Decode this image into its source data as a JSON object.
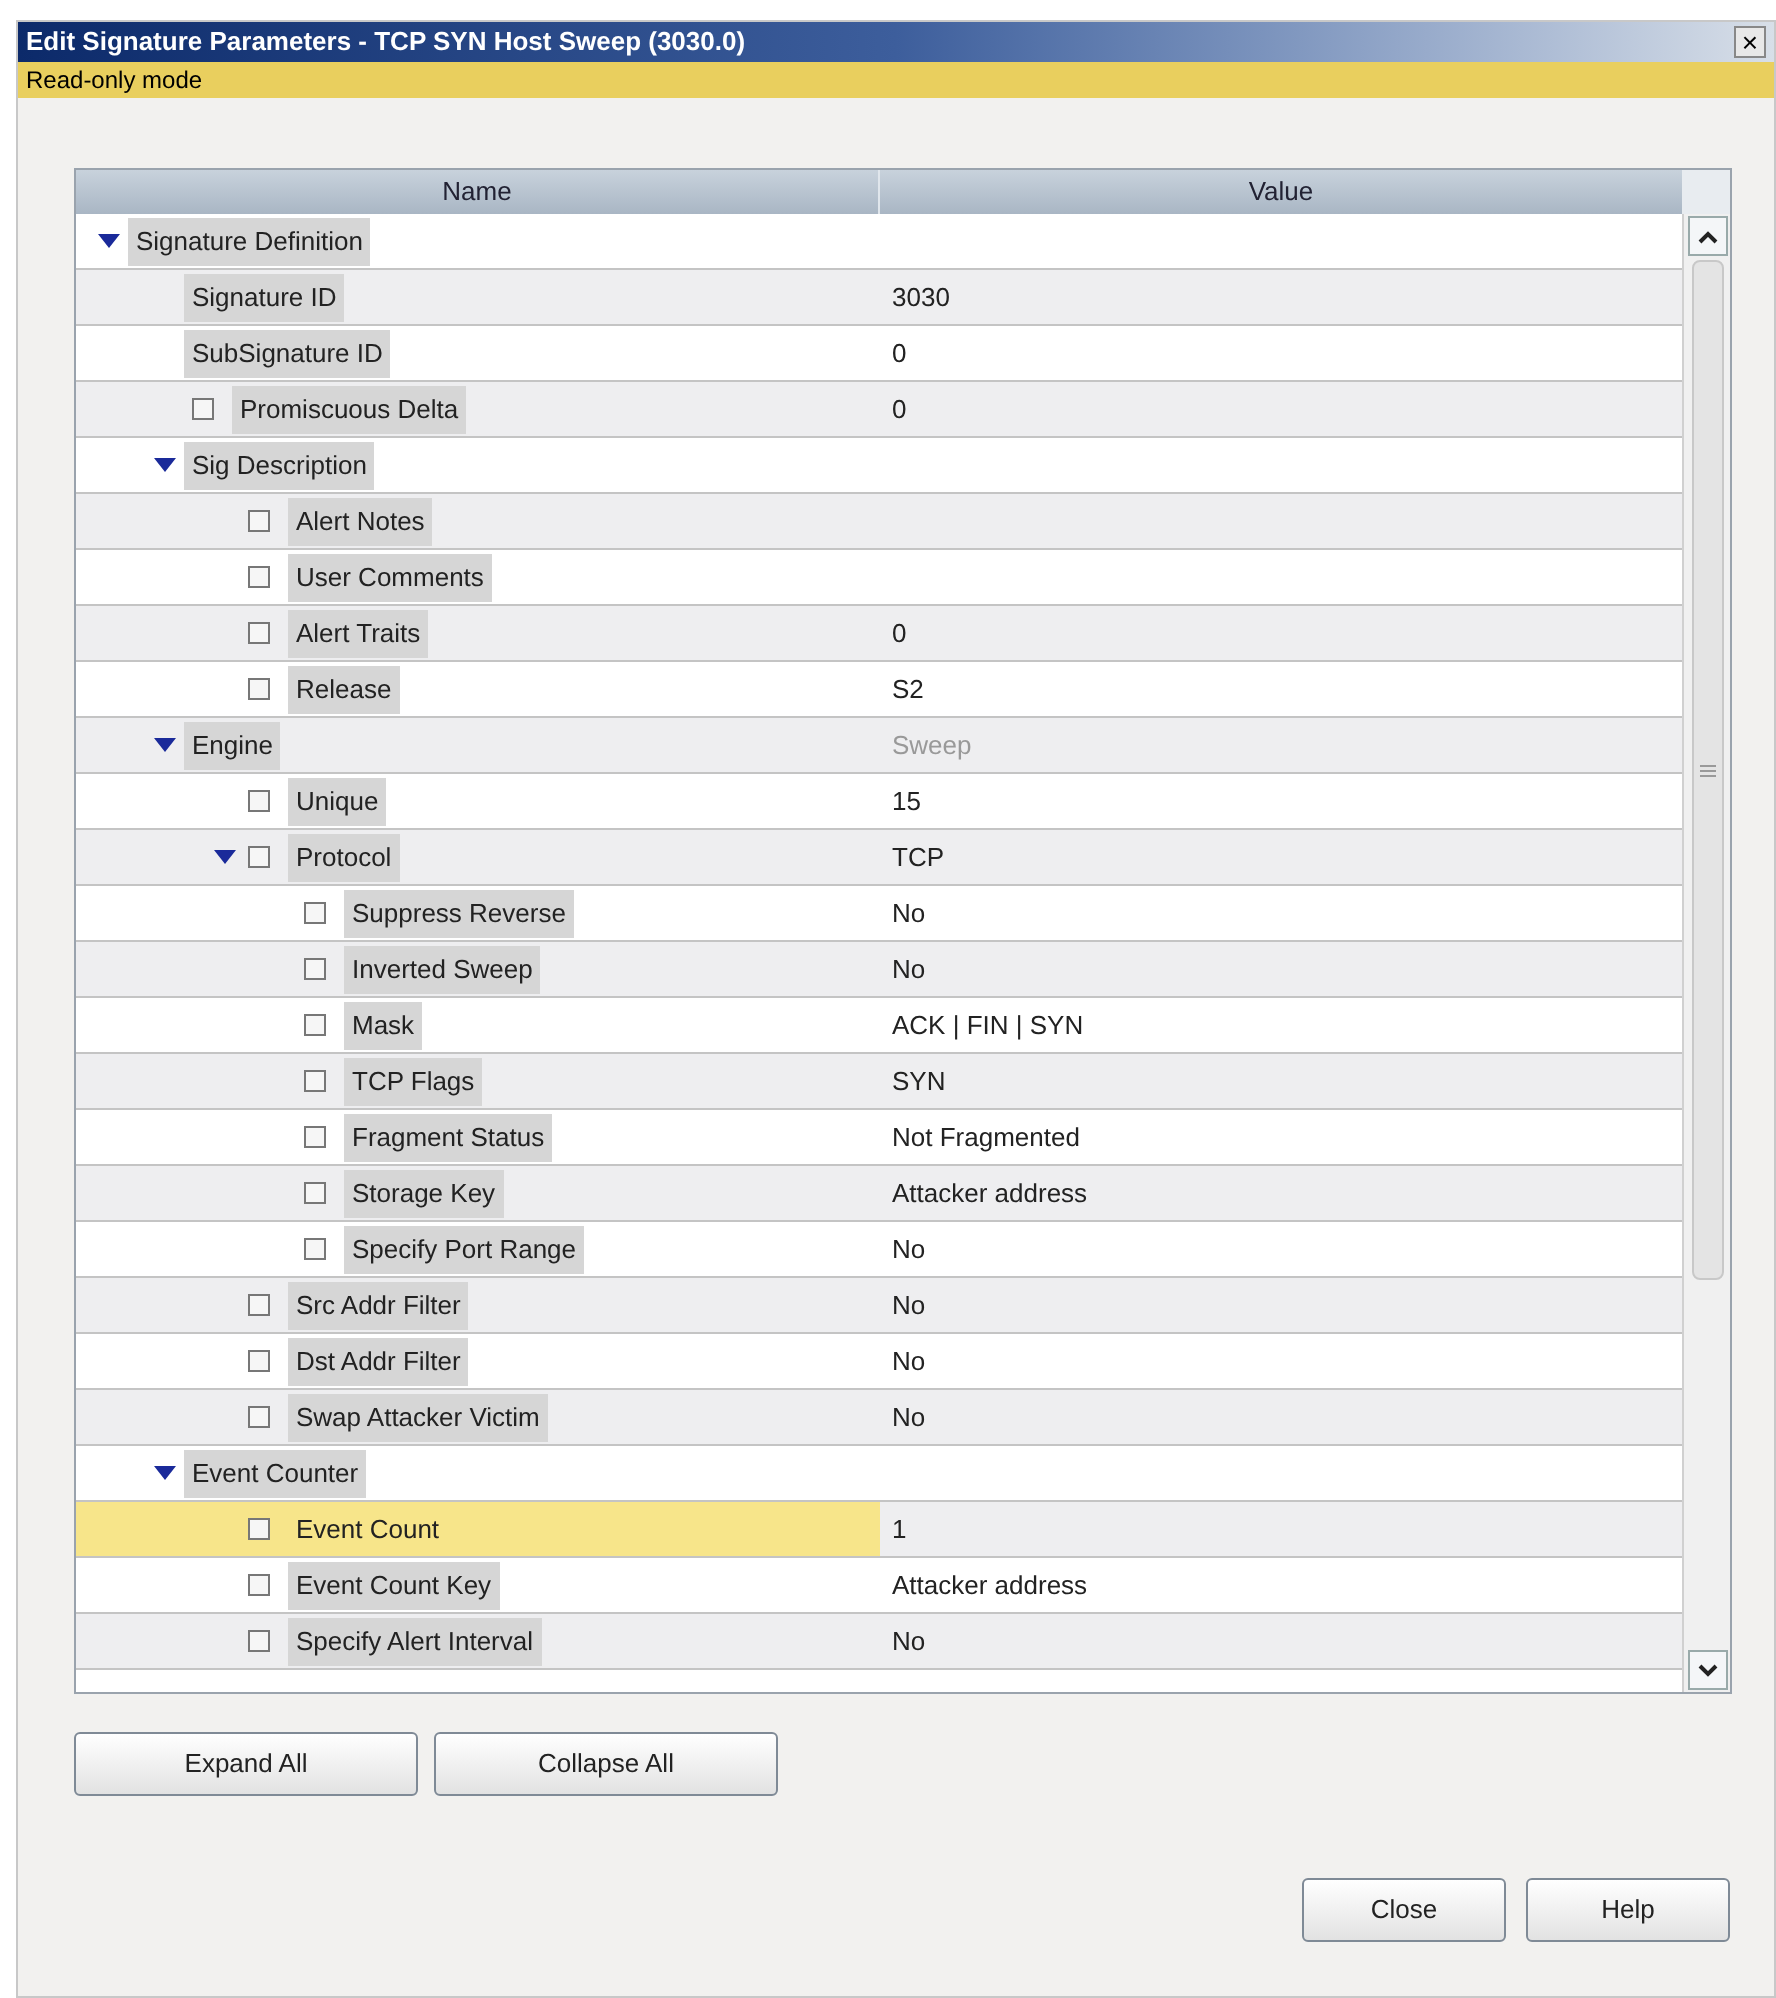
{
  "window": {
    "title": "Edit Signature Parameters - TCP SYN Host Sweep (3030.0)",
    "close_glyph": "×"
  },
  "mode_banner": "Read-only mode",
  "table": {
    "columns": [
      "Name",
      "Value"
    ],
    "rows": [
      {
        "kind": "group",
        "name": "Signature Definition",
        "expanded": true,
        "selected": false,
        "children": [
          {
            "kind": "plain",
            "name": "Signature ID",
            "value": "3030",
            "selected": false
          },
          {
            "kind": "plain",
            "name": "SubSignature ID",
            "value": "0",
            "selected": false
          },
          {
            "kind": "option",
            "name": "Promiscuous Delta",
            "value": "0",
            "checked": false,
            "selected": false
          },
          {
            "kind": "group",
            "name": "Sig Description",
            "expanded": true,
            "selected": false,
            "children": [
              {
                "kind": "option",
                "name": "Alert Notes",
                "checked": false,
                "selected": false
              },
              {
                "kind": "option",
                "name": "User Comments",
                "checked": false,
                "selected": false
              },
              {
                "kind": "option",
                "name": "Alert Traits",
                "value": "0",
                "checked": false,
                "selected": false
              },
              {
                "kind": "option",
                "name": "Release",
                "value": "S2",
                "checked": false,
                "selected": false
              }
            ]
          },
          {
            "kind": "group",
            "name": "Engine",
            "value": "Sweep",
            "value_disabled": true,
            "expanded": true,
            "selected": false,
            "children": [
              {
                "kind": "option",
                "name": "Unique",
                "value": "15",
                "checked": false,
                "selected": false
              },
              {
                "kind": "option",
                "name": "Protocol",
                "value": "TCP",
                "checked": false,
                "expanded": true,
                "selected": false,
                "children": [
                  {
                    "kind": "option",
                    "name": "Suppress Reverse",
                    "value": "No",
                    "checked": false,
                    "selected": false
                  },
                  {
                    "kind": "option",
                    "name": "Inverted Sweep",
                    "value": "No",
                    "checked": false,
                    "selected": false
                  },
                  {
                    "kind": "option",
                    "name": "Mask",
                    "value": "ACK | FIN | SYN",
                    "checked": false,
                    "selected": false
                  },
                  {
                    "kind": "option",
                    "name": "TCP Flags",
                    "value": "SYN",
                    "checked": false,
                    "selected": false
                  },
                  {
                    "kind": "option",
                    "name": "Fragment Status",
                    "value": "Not Fragmented",
                    "checked": false,
                    "selected": false
                  },
                  {
                    "kind": "option",
                    "name": "Storage Key",
                    "value": "Attacker address",
                    "checked": false,
                    "selected": false
                  },
                  {
                    "kind": "option",
                    "name": "Specify Port Range",
                    "value": "No",
                    "checked": false,
                    "selected": false
                  }
                ]
              },
              {
                "kind": "option",
                "name": "Src Addr Filter",
                "value": "No",
                "checked": false,
                "selected": false
              },
              {
                "kind": "option",
                "name": "Dst Addr Filter",
                "value": "No",
                "checked": false,
                "selected": false
              },
              {
                "kind": "option",
                "name": "Swap Attacker Victim",
                "value": "No",
                "checked": false,
                "selected": false
              }
            ]
          },
          {
            "kind": "group",
            "name": "Event Counter",
            "expanded": true,
            "selected": false,
            "children": [
              {
                "kind": "option",
                "name": "Event Count",
                "value": "1",
                "checked": false,
                "selected": true
              },
              {
                "kind": "option",
                "name": "Event Count Key",
                "value": "Attacker address",
                "checked": false,
                "selected": false
              },
              {
                "kind": "option",
                "name": "Specify Alert Interval",
                "value": "No",
                "checked": false,
                "selected": false
              }
            ]
          }
        ]
      }
    ]
  },
  "tree_buttons": [
    "Expand All",
    "Collapse All"
  ],
  "dialog_buttons": [
    "Close",
    "Help"
  ]
}
